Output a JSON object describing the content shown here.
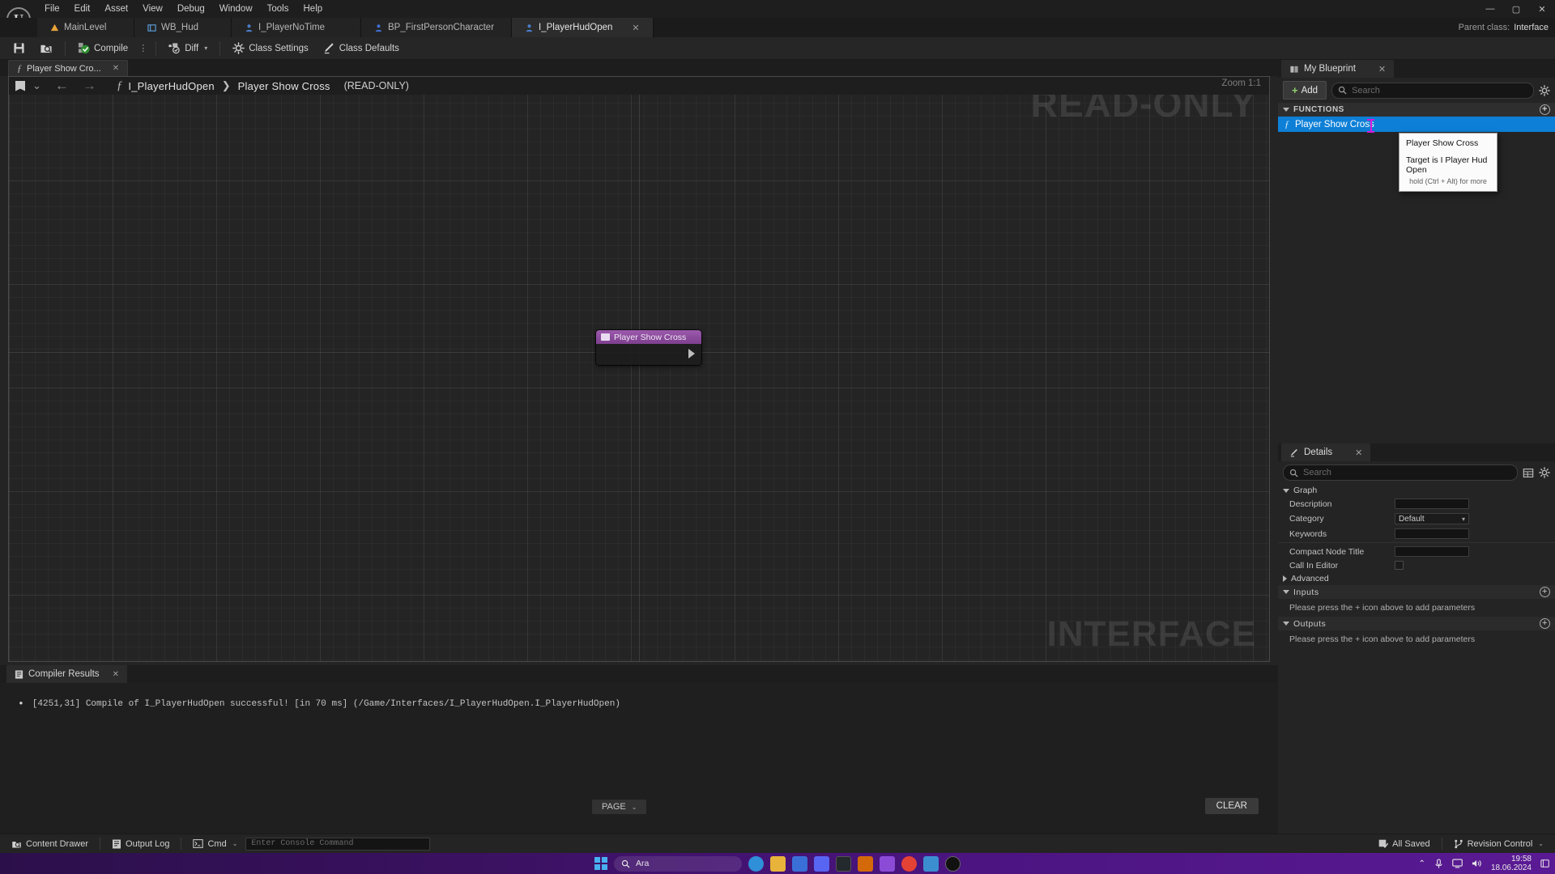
{
  "window": {
    "menu": [
      "File",
      "Edit",
      "Asset",
      "View",
      "Debug",
      "Window",
      "Tools",
      "Help"
    ],
    "controls": {
      "minimize": "—",
      "maximize": "▢",
      "close": "✕"
    },
    "parent_class_label": "Parent class:",
    "parent_class_value": "Interface"
  },
  "asset_tabs": [
    {
      "label": "MainLevel",
      "icon": "level-icon",
      "active": false,
      "closeable": false
    },
    {
      "label": "WB_Hud",
      "icon": "widget-icon",
      "active": false,
      "closeable": false
    },
    {
      "label": "I_PlayerNoTime",
      "icon": "blueprint-icon",
      "active": false,
      "closeable": false
    },
    {
      "label": "BP_FirstPersonCharacter",
      "icon": "blueprint-icon",
      "active": false,
      "closeable": false
    },
    {
      "label": "I_PlayerHudOpen",
      "icon": "blueprint-icon",
      "active": true,
      "closeable": true,
      "close": "✕"
    }
  ],
  "toolbar": {
    "save_icon": "save-icon",
    "browse_icon": "browse-content-icon",
    "compile_label": "Compile",
    "compile_overflow": "⋮",
    "diff_label": "Diff",
    "class_settings_label": "Class Settings",
    "class_defaults_label": "Class Defaults"
  },
  "graph_tabs": [
    {
      "label": "Player Show Cro...",
      "close": "✕"
    }
  ],
  "breadcrumb": {
    "back_arrow": "←",
    "forward_arrow": "→",
    "dropdown_caret": "⌄",
    "root": "I_PlayerHudOpen",
    "separator": "❯",
    "current": "Player Show Cross",
    "readonly_tag": "(READ-ONLY)"
  },
  "graph": {
    "zoom_label": "Zoom 1:1",
    "watermark_top": "READ-ONLY",
    "watermark_bottom": "INTERFACE",
    "node": {
      "title": "Player Show Cross",
      "icon": "function-node-icon"
    }
  },
  "compiler": {
    "tab_label": "Compiler Results",
    "tab_close": "✕",
    "tab_icon": "compiler-results-icon",
    "messages": [
      "[4251,31] Compile of I_PlayerHudOpen successful! [in 70 ms] (/Game/Interfaces/I_PlayerHudOpen.I_PlayerHudOpen)"
    ],
    "page_label": "PAGE",
    "page_caret": "⌄",
    "clear_label": "CLEAR"
  },
  "my_blueprint": {
    "tab_label": "My Blueprint",
    "tab_close": "✕",
    "tab_icon": "blueprint-book-icon",
    "add_label": "Add",
    "add_plus": "+",
    "search_placeholder": "Search",
    "settings_icon": "gear-icon",
    "sections": [
      {
        "title": "FUNCTIONS",
        "add_icon": "+",
        "items": [
          {
            "label": "Player Show Cross",
            "selected": true
          }
        ]
      }
    ]
  },
  "tooltip": {
    "title": "Player Show Cross",
    "target": "Target is I Player Hud Open",
    "hint": "hold (Ctrl + Alt) for more"
  },
  "details": {
    "tab_label": "Details",
    "tab_close": "✕",
    "tab_icon": "details-pencil-icon",
    "search_placeholder": "Search",
    "columns_icon": "columns-icon",
    "settings_icon": "gear-icon",
    "sections": [
      {
        "title": "Graph",
        "expanded": true,
        "rows": [
          {
            "label": "Description",
            "type": "text",
            "value": ""
          },
          {
            "label": "Category",
            "type": "combo",
            "value": "Default"
          },
          {
            "label": "Keywords",
            "type": "text",
            "value": ""
          },
          {
            "label": "Compact Node Title",
            "type": "text",
            "value": ""
          },
          {
            "label": "Call In Editor",
            "type": "checkbox",
            "value": ""
          }
        ]
      }
    ],
    "advanced_label": "Advanced",
    "inputs_label": "Inputs",
    "inputs_hint": "Please press the + icon above to add parameters",
    "outputs_label": "Outputs",
    "outputs_hint": "Please press the + icon above to add parameters"
  },
  "status_bar": {
    "content_drawer": "Content Drawer",
    "output_log": "Output Log",
    "cmd_label": "Cmd",
    "cmd_caret": "⌄",
    "console_placeholder": "Enter Console Command",
    "all_saved": "All Saved",
    "revision_control": "Revision Control",
    "revision_caret": "⌄"
  },
  "taskbar": {
    "search_placeholder": "Ara",
    "search_icon": "search-icon",
    "start_icon": "windows-start-icon",
    "tray": {
      "chevron": "⌃",
      "mic_icon": "microphone-icon",
      "display_icon": "display-icon",
      "volume_icon": "volume-icon",
      "time": "19:58",
      "date": "18.06.2024",
      "notify_icon": "notification-icon"
    },
    "apps": [
      {
        "name": "edge-app",
        "color": "#2f8fd8"
      },
      {
        "name": "explorer-app",
        "color": "#e8b33a"
      },
      {
        "name": "store-app",
        "color": "#3a6fd8"
      },
      {
        "name": "discord-app",
        "color": "#5865f2"
      },
      {
        "name": "github-app",
        "color": "#24292e"
      },
      {
        "name": "vscode-app",
        "color": "#d4690a"
      },
      {
        "name": "vs-app",
        "color": "#8b4bd6"
      },
      {
        "name": "chrome-app",
        "color": "#e44235"
      },
      {
        "name": "media-app",
        "color": "#3b8ed0"
      },
      {
        "name": "unreal-app",
        "color": "#1a1a1a"
      }
    ]
  }
}
